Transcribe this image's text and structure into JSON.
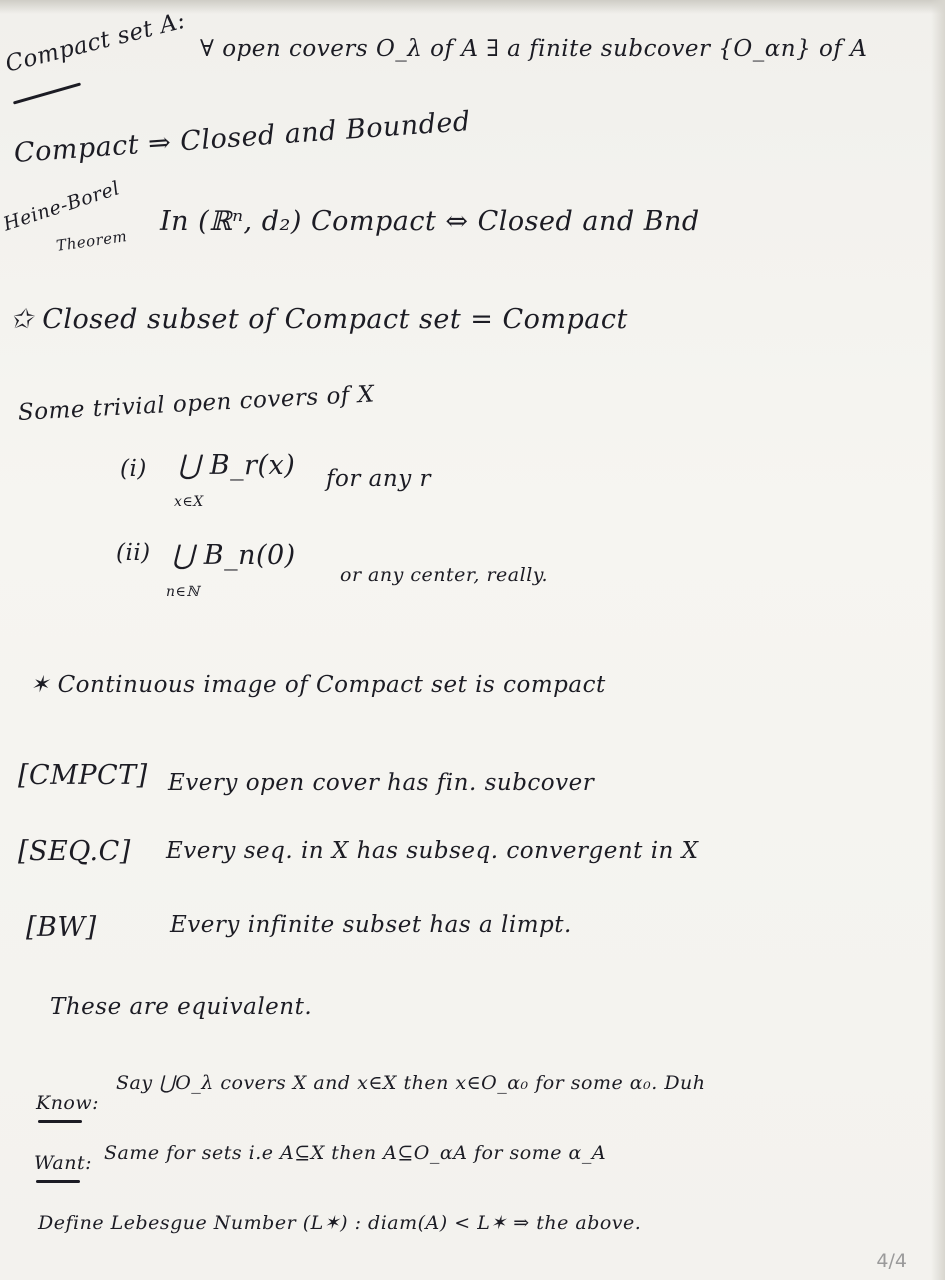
{
  "lines": {
    "l1": {
      "label": "Compact set A:",
      "text": "∀ open covers O_λ of A  ∃ a finite subcover {O_αn} of A"
    },
    "l2": {
      "text": "Compact ⇒ Closed and Bounded"
    },
    "l3": {
      "label": "Heine-Borel",
      "label2": "Theorem",
      "text": "In (ℝⁿ, d₂)   Compact ⇔ Closed and Bnd"
    },
    "l4": {
      "text": "✩ Closed subset of Compact set  =  Compact"
    },
    "l5": {
      "text": "Some trivial open covers of X"
    },
    "l6": {
      "num": "(i)",
      "expr": "⋃ B_r(x)",
      "sub": "x∈X",
      "rest": "for any r"
    },
    "l7": {
      "num": "(ii)",
      "expr": "⋃ B_n(0)",
      "sub": "n∈ℕ",
      "rest": "or any center, really."
    },
    "l8": {
      "text": "✶ Continuous image of Compact set is compact"
    },
    "l9": {
      "tag": "[CMPCT]",
      "text": "Every open cover has fin. subcover"
    },
    "l10": {
      "tag": "[SEQ.C]",
      "text": "Every seq. in X has subseq. convergent in X"
    },
    "l11": {
      "tag": "[BW]",
      "text": "Every infinite subset has a limpt."
    },
    "l12": {
      "text": "These are equivalent."
    },
    "l13": {
      "label": "Know:",
      "text": "Say ⋃O_λ covers X and x∈X then x∈O_α₀ for some α₀. Duh"
    },
    "l14": {
      "label": "Want:",
      "text": "Same for sets i.e A⊆X then A⊆O_αA for some α_A"
    },
    "l15": {
      "text": "Define Lebesgue Number (L✶) :  diam(A) < L✶ ⇒ the above."
    }
  },
  "page_number": "4/4"
}
